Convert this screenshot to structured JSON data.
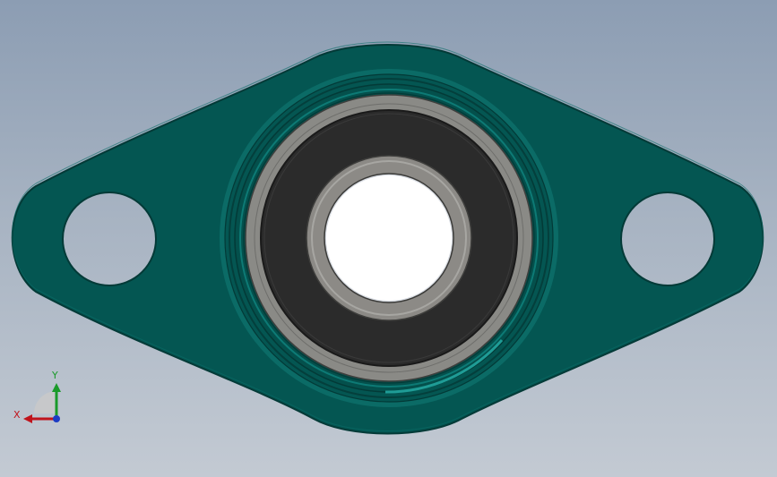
{
  "viewport": {
    "background_top": "#8c9db3",
    "background_bottom": "#c3cad3"
  },
  "model": {
    "flange_color": "#045652",
    "seal_color": "#2b2b2b",
    "ring_color": "#8a8a86"
  },
  "triad": {
    "x_label": "X",
    "y_label": "Y",
    "x_color": "#c0141c",
    "y_color": "#1a9a2a",
    "z_color": "#1c3cc4"
  }
}
